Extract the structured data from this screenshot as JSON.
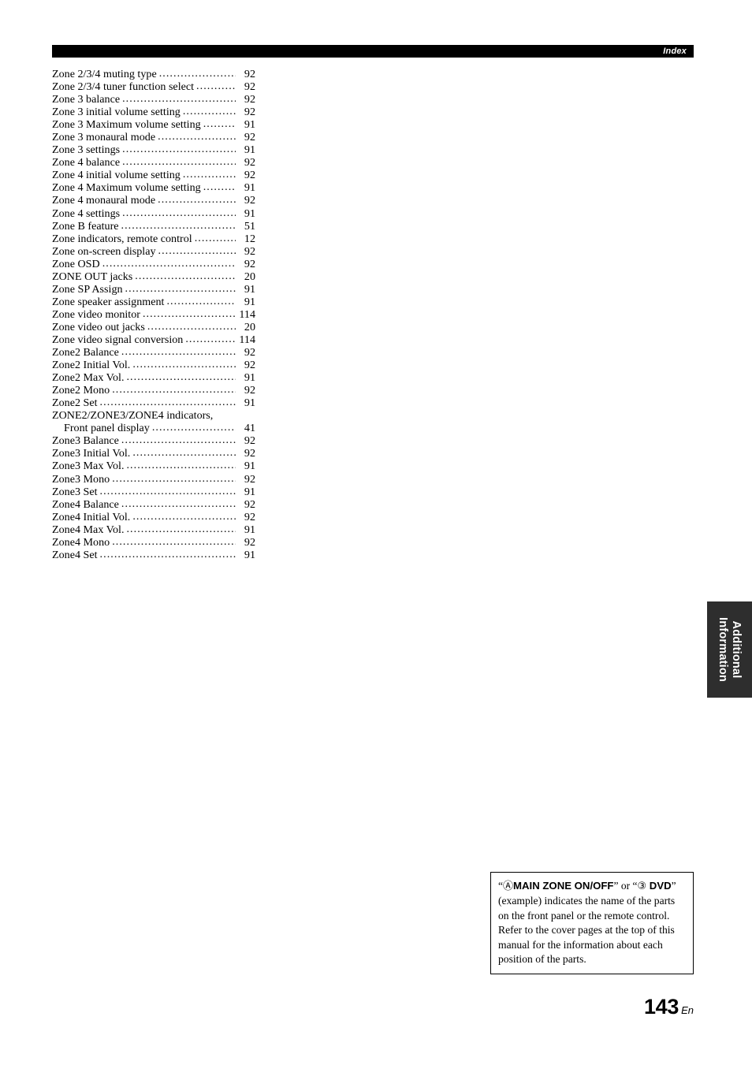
{
  "header": {
    "title": "Index"
  },
  "index": {
    "entries": [
      {
        "label": "Zone 2/3/4 muting type",
        "page": "92",
        "indent": false,
        "leader": true
      },
      {
        "label": "Zone 2/3/4 tuner function select",
        "page": "92",
        "indent": false,
        "leader": true
      },
      {
        "label": "Zone 3 balance",
        "page": "92",
        "indent": false,
        "leader": true
      },
      {
        "label": "Zone 3 initial volume setting",
        "page": "92",
        "indent": false,
        "leader": true
      },
      {
        "label": "Zone 3 Maximum volume setting",
        "page": "91",
        "indent": false,
        "leader": true
      },
      {
        "label": "Zone 3 monaural mode",
        "page": "92",
        "indent": false,
        "leader": true
      },
      {
        "label": "Zone 3 settings",
        "page": "91",
        "indent": false,
        "leader": true
      },
      {
        "label": "Zone 4 balance",
        "page": "92",
        "indent": false,
        "leader": true
      },
      {
        "label": "Zone 4 initial volume setting",
        "page": "92",
        "indent": false,
        "leader": true
      },
      {
        "label": "Zone 4 Maximum volume setting",
        "page": "91",
        "indent": false,
        "leader": true
      },
      {
        "label": "Zone 4 monaural mode",
        "page": "92",
        "indent": false,
        "leader": true
      },
      {
        "label": "Zone 4 settings",
        "page": "91",
        "indent": false,
        "leader": true
      },
      {
        "label": "Zone B feature",
        "page": "51",
        "indent": false,
        "leader": true
      },
      {
        "label": "Zone indicators, remote control",
        "page": "12",
        "indent": false,
        "leader": true
      },
      {
        "label": "Zone on-screen display",
        "page": "92",
        "indent": false,
        "leader": true
      },
      {
        "label": "Zone OSD",
        "page": "92",
        "indent": false,
        "leader": true
      },
      {
        "label": "ZONE OUT jacks",
        "page": "20",
        "indent": false,
        "leader": true
      },
      {
        "label": "Zone SP Assign",
        "page": "91",
        "indent": false,
        "leader": true
      },
      {
        "label": "Zone speaker assignment",
        "page": "91",
        "indent": false,
        "leader": true
      },
      {
        "label": "Zone video monitor",
        "page": "114",
        "indent": false,
        "leader": true
      },
      {
        "label": "Zone video out jacks",
        "page": "20",
        "indent": false,
        "leader": true
      },
      {
        "label": "Zone video signal conversion",
        "page": "114",
        "indent": false,
        "leader": true
      },
      {
        "label": "Zone2 Balance",
        "page": "92",
        "indent": false,
        "leader": true
      },
      {
        "label": "Zone2 Initial Vol.",
        "page": "92",
        "indent": false,
        "leader": true
      },
      {
        "label": "Zone2 Max Vol.",
        "page": "91",
        "indent": false,
        "leader": true
      },
      {
        "label": "Zone2 Mono",
        "page": "92",
        "indent": false,
        "leader": true
      },
      {
        "label": "Zone2 Set",
        "page": "91",
        "indent": false,
        "leader": true
      },
      {
        "label": "ZONE2/ZONE3/ZONE4 indicators,",
        "page": "",
        "indent": false,
        "leader": false
      },
      {
        "label": "Front panel display",
        "page": "41",
        "indent": true,
        "leader": true
      },
      {
        "label": "Zone3 Balance",
        "page": "92",
        "indent": false,
        "leader": true
      },
      {
        "label": "Zone3 Initial Vol.",
        "page": "92",
        "indent": false,
        "leader": true
      },
      {
        "label": "Zone3 Max Vol.",
        "page": "91",
        "indent": false,
        "leader": true
      },
      {
        "label": "Zone3 Mono",
        "page": "92",
        "indent": false,
        "leader": true
      },
      {
        "label": "Zone3 Set",
        "page": "91",
        "indent": false,
        "leader": true
      },
      {
        "label": "Zone4 Balance",
        "page": "92",
        "indent": false,
        "leader": true
      },
      {
        "label": "Zone4 Initial Vol.",
        "page": "92",
        "indent": false,
        "leader": true
      },
      {
        "label": "Zone4 Max Vol.",
        "page": "91",
        "indent": false,
        "leader": true
      },
      {
        "label": "Zone4 Mono",
        "page": "92",
        "indent": false,
        "leader": true
      },
      {
        "label": "Zone4 Set",
        "page": "91",
        "indent": false,
        "leader": true
      }
    ]
  },
  "side_tab": {
    "label": "Additional Information",
    "background_color": "#2e2e2e",
    "text_color": "#ffffff"
  },
  "note_box": {
    "head_open_quote": "“",
    "head_circled_a": "Ⓐ",
    "head_part_a": "MAIN ZONE ON/OFF",
    "head_mid": "” or “",
    "head_circled_3": "③",
    "head_part_b": "DVD",
    "head_close_quote": "”",
    "body": "(example) indicates the name of the parts on the front panel or the remote control. Refer to the cover pages at the top of this manual for the information about each position of the parts."
  },
  "folio": {
    "number": "143",
    "suffix": "En"
  }
}
